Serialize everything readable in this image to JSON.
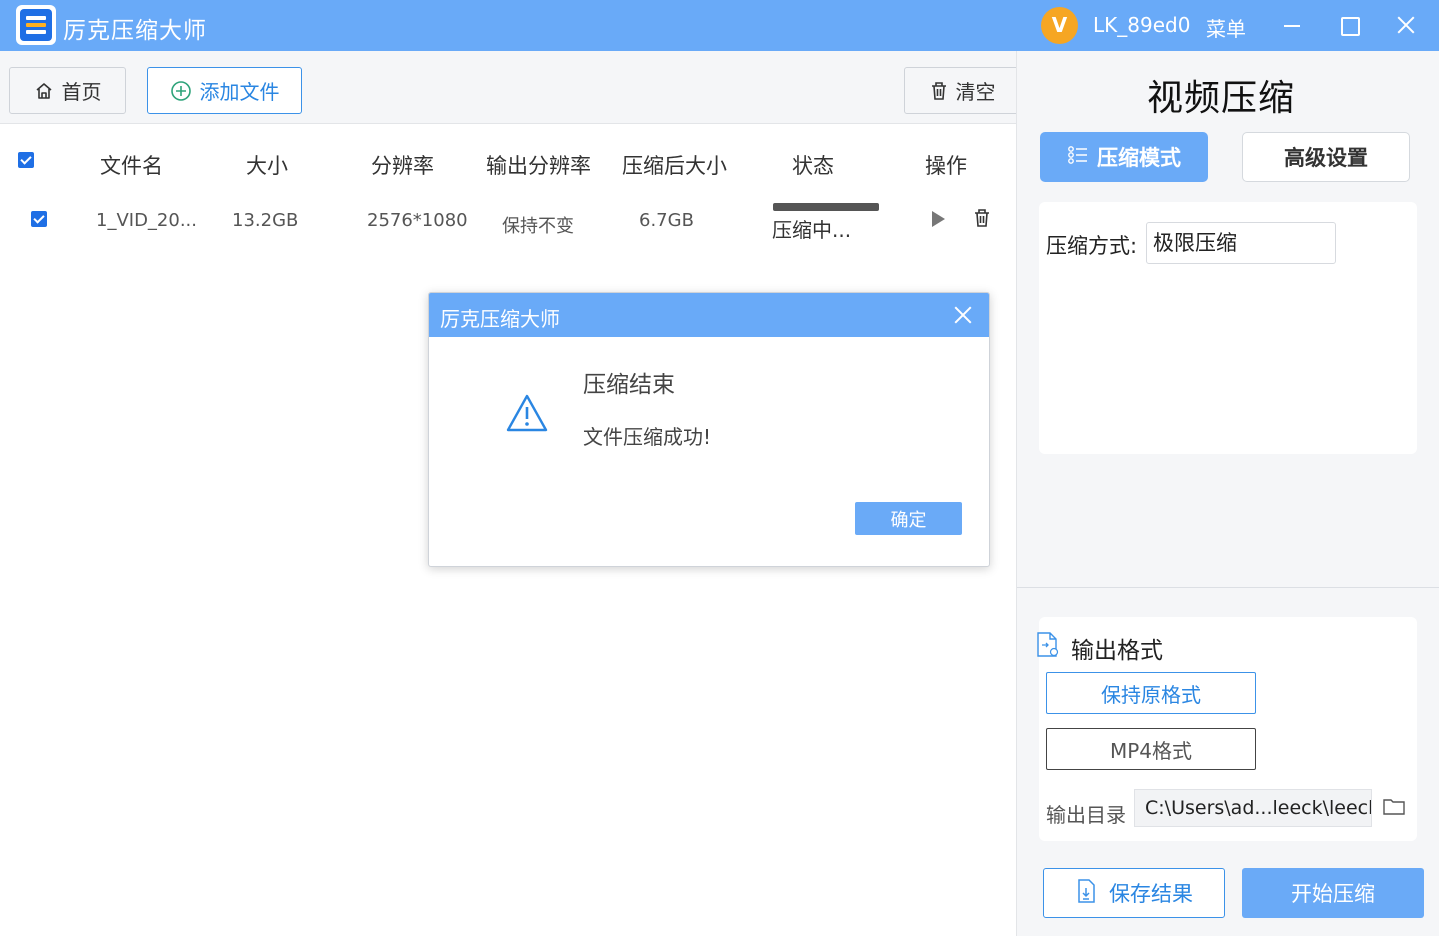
{
  "titlebar": {
    "app_title": "厉克压缩大师",
    "avatar_letter": "V",
    "username": "LK_89ed0",
    "menu_label": "菜单"
  },
  "toolbar": {
    "home_label": "首页",
    "add_label": "添加文件",
    "clear_label": "清空"
  },
  "table": {
    "columns": [
      "文件名",
      "大小",
      "分辨率",
      "输出分辨率",
      "压缩后大小",
      "状态",
      "操作"
    ],
    "rows": [
      {
        "name": "1_VID_20...",
        "size": "13.2GB",
        "resolution": "2576*1080",
        "out_resolution": "保持不变",
        "compressed_size": "6.7GB",
        "status": "压缩中...",
        "progress": 1.0,
        "checked": true
      }
    ]
  },
  "panel": {
    "title": "视频压缩",
    "tab_mode": "压缩模式",
    "tab_advanced": "高级设置",
    "method_label": "压缩方式:",
    "method_value": "极限压缩",
    "output_title": "输出格式",
    "format_keep": "保持原格式",
    "format_mp4": "MP4格式",
    "output_dir_label": "输出目录",
    "output_dir_value": "C:\\Users\\ad...leeck\\leeck",
    "save_label": "保存结果",
    "start_label": "开始压缩"
  },
  "dialog": {
    "title": "厉克压缩大师",
    "heading": "压缩结束",
    "message": "文件压缩成功!",
    "ok_label": "确定"
  },
  "colors": {
    "accent": "#69aaf8",
    "primary_blue": "#2a86e2",
    "checkbox_blue": "#1f6fe5",
    "avatar_orange": "#f6a623"
  },
  "icons": [
    "app-logo-icon",
    "home-icon",
    "add-circle-icon",
    "trash-icon",
    "settings-sliders-icon",
    "file-format-icon",
    "folder-icon",
    "save-file-icon",
    "play-icon",
    "warning-icon",
    "close-icon",
    "minimize-icon",
    "maximize-icon"
  ]
}
